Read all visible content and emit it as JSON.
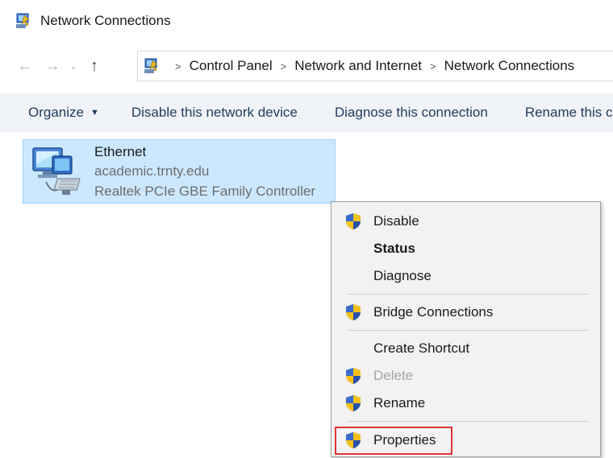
{
  "window": {
    "title": "Network Connections",
    "icon": "network-connections-icon"
  },
  "nav": {
    "back": "←",
    "forward": "→",
    "dropdown": "⌄",
    "up": "↑",
    "separator": ">",
    "breadcrumbs": [
      "Control Panel",
      "Network and Internet",
      "Network Connections"
    ]
  },
  "commands": {
    "organize": "Organize",
    "disable_device": "Disable this network device",
    "diagnose_connection": "Diagnose this connection",
    "rename": "Rename this connection"
  },
  "connection": {
    "name": "Ethernet",
    "domain": "academic.trnty.edu",
    "adapter": "Realtek PCIe GBE Family Controller"
  },
  "context_menu": {
    "items": [
      {
        "label": "Disable",
        "shield": true,
        "style": "normal"
      },
      {
        "label": "Status",
        "shield": false,
        "style": "bold"
      },
      {
        "label": "Diagnose",
        "shield": false,
        "style": "normal"
      },
      {
        "label": "Bridge Connections",
        "shield": true,
        "style": "normal"
      },
      {
        "label": "Create Shortcut",
        "shield": false,
        "style": "normal"
      },
      {
        "label": "Delete",
        "shield": true,
        "style": "disabled"
      },
      {
        "label": "Rename",
        "shield": true,
        "style": "normal"
      },
      {
        "label": "Properties",
        "shield": true,
        "style": "highlighted"
      }
    ]
  },
  "colors": {
    "selection_fill": "#cce8ff",
    "selection_border": "#99d1ff",
    "highlight_box": "#e03535",
    "command_bar": "#f0f3f7"
  }
}
